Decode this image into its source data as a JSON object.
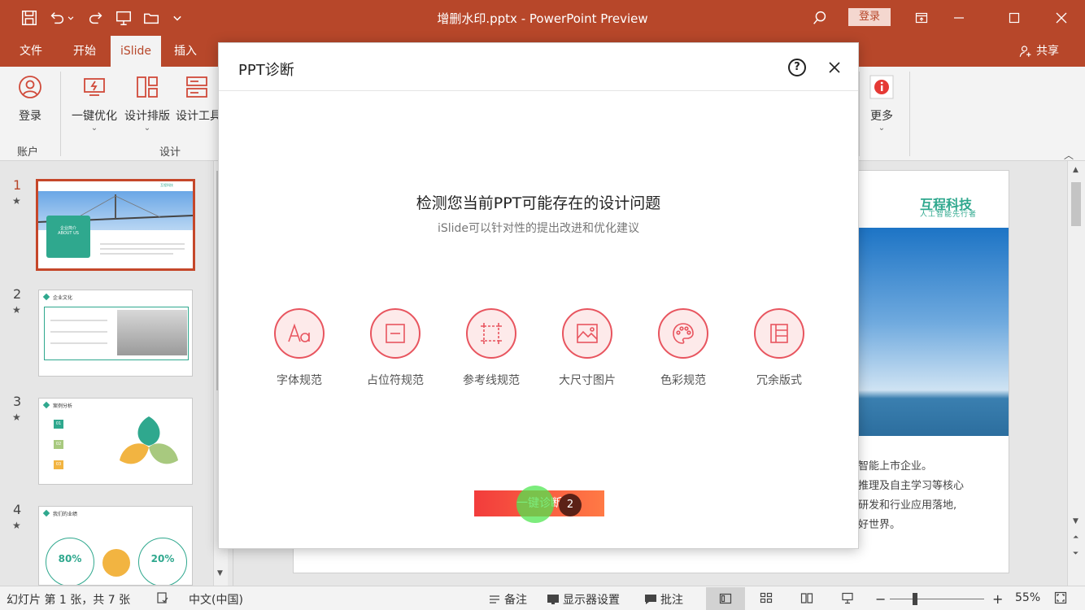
{
  "window": {
    "title": "增删水印.pptx  -  PowerPoint Preview",
    "login_label": "登录"
  },
  "tabs": {
    "items": [
      {
        "label": "文件"
      },
      {
        "label": "开始"
      },
      {
        "label": "iSlide"
      },
      {
        "label": "插入"
      }
    ],
    "active": "iSlide",
    "share_label": "共享"
  },
  "ribbon": {
    "login": "登录",
    "optimize": "一键优化",
    "layout": "设计排版",
    "tools": "设计工具",
    "more": "更多",
    "group_account": "账户",
    "group_design": "设计"
  },
  "slides": {
    "numbers": [
      "1",
      "2",
      "3",
      "4"
    ],
    "star": "★",
    "t1": {
      "heading": "企业简介",
      "sub": "ABOUT US",
      "brand": "互程科技"
    },
    "t2": {
      "heading": "企业文化"
    },
    "t3": {
      "heading": "案例分析",
      "n1": "01",
      "n2": "02",
      "n3": "03"
    },
    "t4": {
      "heading": "我们的业绩",
      "p1": "80%",
      "p2": "20%"
    }
  },
  "canvas": {
    "brand": "互程科技",
    "slogan": "人工智能先行者",
    "lines": [
      "智能上市企业。",
      "推理及自主学习等核心",
      "研发和行业应用落地,",
      "好世界。"
    ]
  },
  "dialog": {
    "title": "PPT诊断",
    "help": "?",
    "heading": "检测您当前PPT可能存在的设计问题",
    "subheading": "iSlide可以针对性的提出改进和优化建议",
    "features": [
      {
        "label": "字体规范",
        "icon": "font-icon"
      },
      {
        "label": "占位符规范",
        "icon": "placeholder-icon"
      },
      {
        "label": "参考线规范",
        "icon": "guides-icon"
      },
      {
        "label": "大尺寸图片",
        "icon": "image-icon"
      },
      {
        "label": "色彩规范",
        "icon": "palette-icon"
      },
      {
        "label": "冗余版式",
        "icon": "layout-icon"
      }
    ],
    "button": "一键诊断",
    "step": "2"
  },
  "status": {
    "slide_info": "幻灯片 第 1 张，共 7 张",
    "language": "中文(中国)",
    "notes": "备注",
    "display": "显示器设置",
    "comments": "批注",
    "zoom": "55%",
    "minus": "−",
    "plus": "+"
  },
  "colors": {
    "brand": "#b7472a",
    "accent_red": "#e8555f",
    "teal": "#2fa88e"
  }
}
